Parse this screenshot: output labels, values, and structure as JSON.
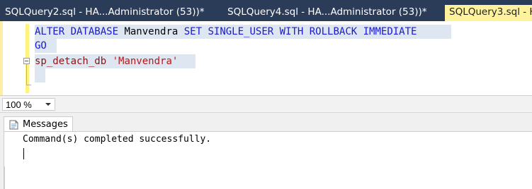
{
  "tabs": [
    {
      "label": "SQLQuery2.sql - HA...Administrator (53))*",
      "active": false
    },
    {
      "label": "SQLQuery4.sql - HA...Administrator (53))*",
      "active": false
    },
    {
      "label": "SQLQuery3.sql - HA",
      "active": true
    }
  ],
  "editor": {
    "line1": {
      "kw1": "ALTER DATABASE",
      "name": "Manvendra",
      "kw2": "SET SINGLE_USER WITH ROLLBACK IMMEDIATE"
    },
    "line2": {
      "kw": "GO"
    },
    "line3": {
      "proc": "sp_detach_db",
      "arg": "'Manvendra'"
    }
  },
  "zoom": {
    "value": "100 %"
  },
  "results": {
    "tab_label": "Messages",
    "message": "Command(s) completed successfully."
  },
  "colors": {
    "tabstrip_bg": "#2b3c59",
    "active_tab_bg": "#fff29d",
    "keyword": "#1a18d6",
    "string": "#b51a18",
    "selection": "#dde6f1"
  }
}
